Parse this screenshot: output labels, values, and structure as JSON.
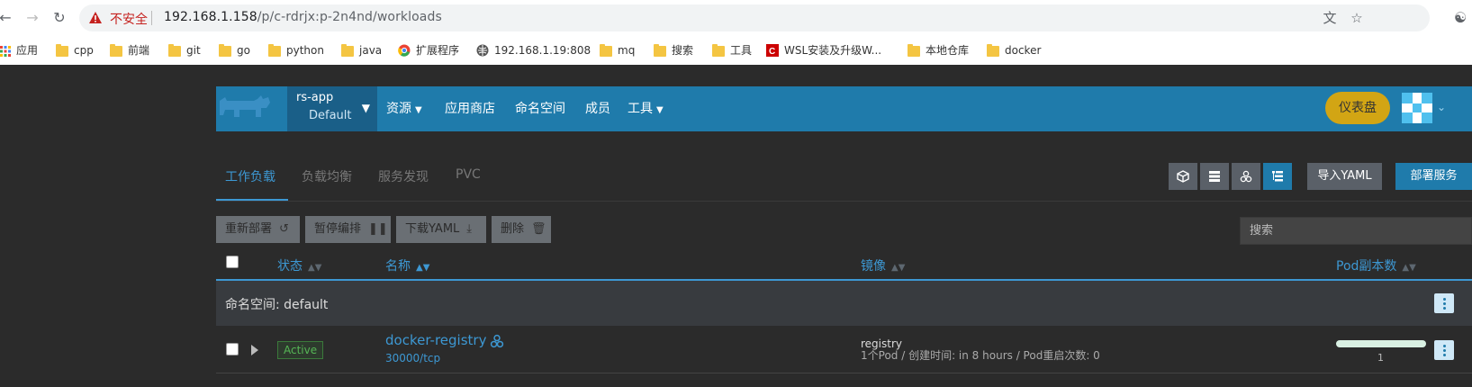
{
  "browser": {
    "insecure_label": "不安全",
    "url_host": "192.168.1.158",
    "url_path": "/p/c-rdrjx:p-2n4nd/workloads"
  },
  "bookmarks": [
    {
      "label": "应用",
      "icon": "apps-grid-icon"
    },
    {
      "label": "cpp",
      "icon": "folder-icon"
    },
    {
      "label": "前端",
      "icon": "folder-icon"
    },
    {
      "label": "git",
      "icon": "folder-icon"
    },
    {
      "label": "go",
      "icon": "folder-icon"
    },
    {
      "label": "python",
      "icon": "folder-icon"
    },
    {
      "label": "java",
      "icon": "folder-icon"
    },
    {
      "label": "扩展程序",
      "icon": "chrome-extensions-icon"
    },
    {
      "label": "192.168.1.19:808",
      "icon": "globe-icon"
    },
    {
      "label": "mq",
      "icon": "folder-icon"
    },
    {
      "label": "搜索",
      "icon": "folder-icon"
    },
    {
      "label": "工具",
      "icon": "folder-icon"
    },
    {
      "label": "WSL安装及升级W...",
      "icon": "csdn-icon"
    },
    {
      "label": "本地仓库",
      "icon": "folder-icon"
    },
    {
      "label": "docker",
      "icon": "folder-icon"
    }
  ],
  "header": {
    "context_name": "rs-app",
    "context_sub": "Default",
    "nav": [
      "资源",
      "应用商店",
      "命名空间",
      "成员",
      "工具"
    ],
    "dashboard_label": "仪表盘",
    "accent": "#1f7bab"
  },
  "tabs": [
    "工作负载",
    "负载均衡",
    "服务发现",
    "PVC"
  ],
  "actions": {
    "import_yaml": "导入YAML",
    "deploy_service": "部署服务",
    "redeploy": "重新部署",
    "pause": "暂停编排",
    "download_yaml": "下载YAML",
    "delete": "删除",
    "search_placeholder": "搜索"
  },
  "table": {
    "headers": {
      "state": "状态",
      "name": "名称",
      "image": "镜像",
      "pods": "Pod副本数"
    },
    "group_label": "命名空间: default",
    "rows": [
      {
        "state": "Active",
        "name": "docker-registry",
        "port": "30000/tcp",
        "image": "registry",
        "meta": "1个Pod / 创建时间: in 8 hours / Pod重启次数: 0",
        "pod_count": "1",
        "pod_ready_fraction": 1.0
      }
    ]
  }
}
